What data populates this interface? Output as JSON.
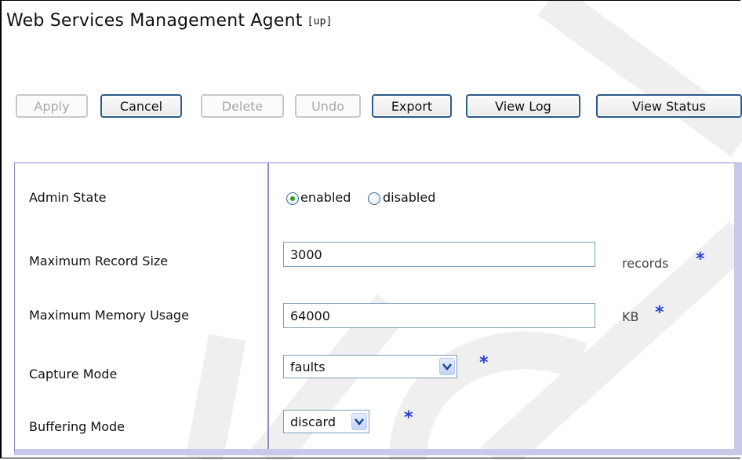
{
  "header": {
    "title": "Web Services Management Agent",
    "status": "[up]"
  },
  "toolbar": {
    "buttons": [
      {
        "label": "Apply",
        "enabled": false
      },
      {
        "label": "Cancel",
        "enabled": true
      },
      {
        "label": "Delete",
        "enabled": false
      },
      {
        "label": "Undo",
        "enabled": false
      },
      {
        "label": "Export",
        "enabled": true
      },
      {
        "label": "View Log",
        "enabled": true
      },
      {
        "label": "View Status",
        "enabled": true
      }
    ]
  },
  "form": {
    "admin_state": {
      "label": "Admin State",
      "options": [
        "enabled",
        "disabled"
      ],
      "selected": "enabled"
    },
    "max_record_size": {
      "label": "Maximum Record Size",
      "value": "3000",
      "unit": "records",
      "required": "*"
    },
    "max_memory_usage": {
      "label": "Maximum Memory Usage",
      "value": "64000",
      "unit": "KB",
      "required": "*"
    },
    "capture_mode": {
      "label": "Capture Mode",
      "value": "faults",
      "required": "*"
    },
    "buffering_mode": {
      "label": "Buffering Mode",
      "value": "discard",
      "required": "*"
    }
  },
  "colors": {
    "required_marker": "#2c3ed8",
    "panel_border": "#8a8ac8",
    "button_border": "#2a5a8a",
    "selected_radio": "#2e9a22"
  }
}
